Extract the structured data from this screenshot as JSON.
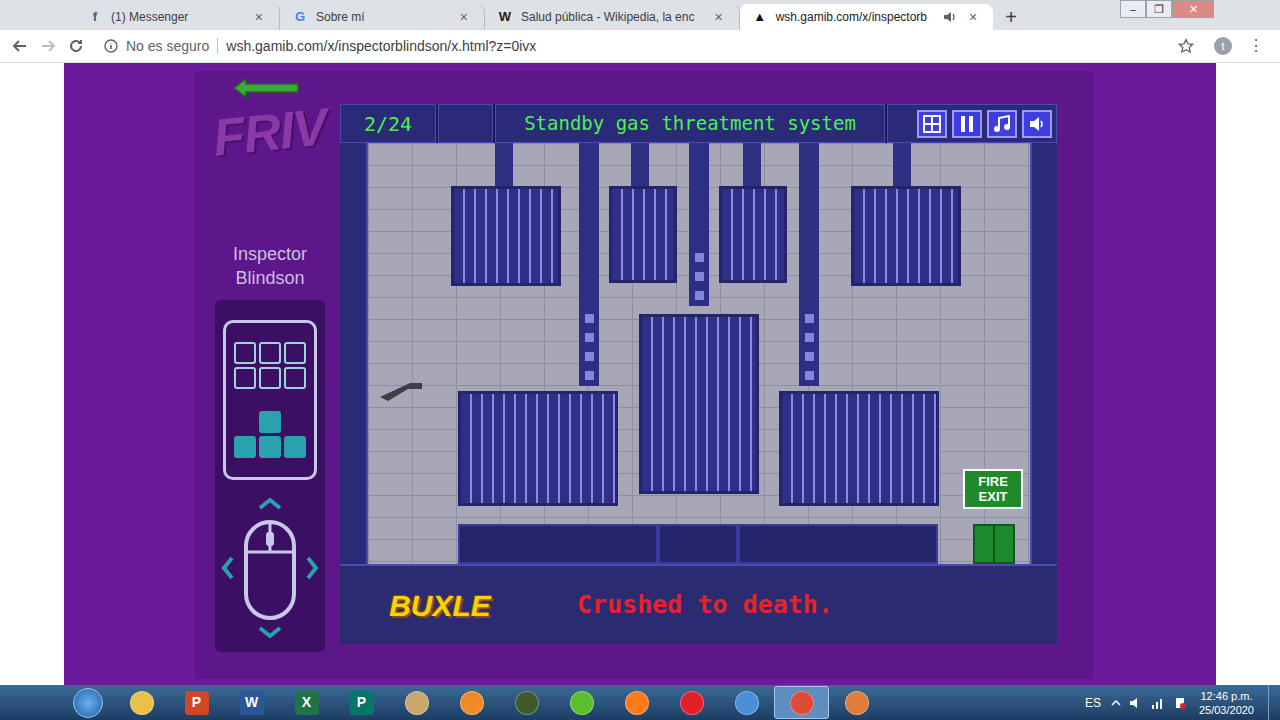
{
  "browser": {
    "tabs": [
      {
        "icon": "f",
        "label": "(1) Messenger",
        "close": "×",
        "selected": false
      },
      {
        "icon": "G",
        "label": "Sobre mí",
        "close": "×",
        "selected": false
      },
      {
        "icon": "W",
        "label": "Salud pública - Wikipedia, la enc",
        "close": "×",
        "selected": false
      },
      {
        "icon": "▲",
        "label": "wsh.gamib.com/x/inspectorb",
        "close": "×",
        "selected": true
      }
    ],
    "new_tab": "+",
    "window_controls": [
      "–",
      "❐",
      "✕"
    ],
    "address": {
      "security": "No es seguro",
      "url": "wsh.gamib.com/x/inspectorblindson/x.html?z=0ivx",
      "profile": "t",
      "menu": "⋮"
    }
  },
  "game": {
    "sidebar": {
      "logo": "FRIV",
      "title": "Inspector Blindson"
    },
    "level": "2/24",
    "level_name": "Standby gas threatment system",
    "message": "Crushed to death.",
    "sign": "FIRE EXIT",
    "sponsor": "BUXLE"
  },
  "taskbar": {
    "apps": [
      {
        "glyph": "",
        "color": "#e8c04a",
        "selected": false
      },
      {
        "glyph": "P",
        "color": "#d24726",
        "selected": false
      },
      {
        "glyph": "W",
        "color": "#2b579a",
        "selected": false
      },
      {
        "glyph": "X",
        "color": "#217346",
        "selected": false
      },
      {
        "glyph": "P",
        "color": "#077568",
        "selected": false
      },
      {
        "glyph": "",
        "color": "#c9a66b",
        "selected": false
      },
      {
        "glyph": "",
        "color": "#f08a24",
        "selected": false
      },
      {
        "glyph": "",
        "color": "#3f5a2a",
        "selected": false
      },
      {
        "glyph": "",
        "color": "#5bbf2a",
        "selected": false
      },
      {
        "glyph": "",
        "color": "#ff7a1a",
        "selected": false
      },
      {
        "glyph": "",
        "color": "#e3202a",
        "selected": false
      },
      {
        "glyph": "",
        "color": "#4a8fd8",
        "selected": false
      },
      {
        "glyph": "",
        "color": "#dd4b39",
        "selected": true
      },
      {
        "glyph": "",
        "color": "#e07b39",
        "selected": false
      }
    ],
    "language": "ES",
    "time": "12:46 p.m.",
    "date": "25/03/2020"
  }
}
